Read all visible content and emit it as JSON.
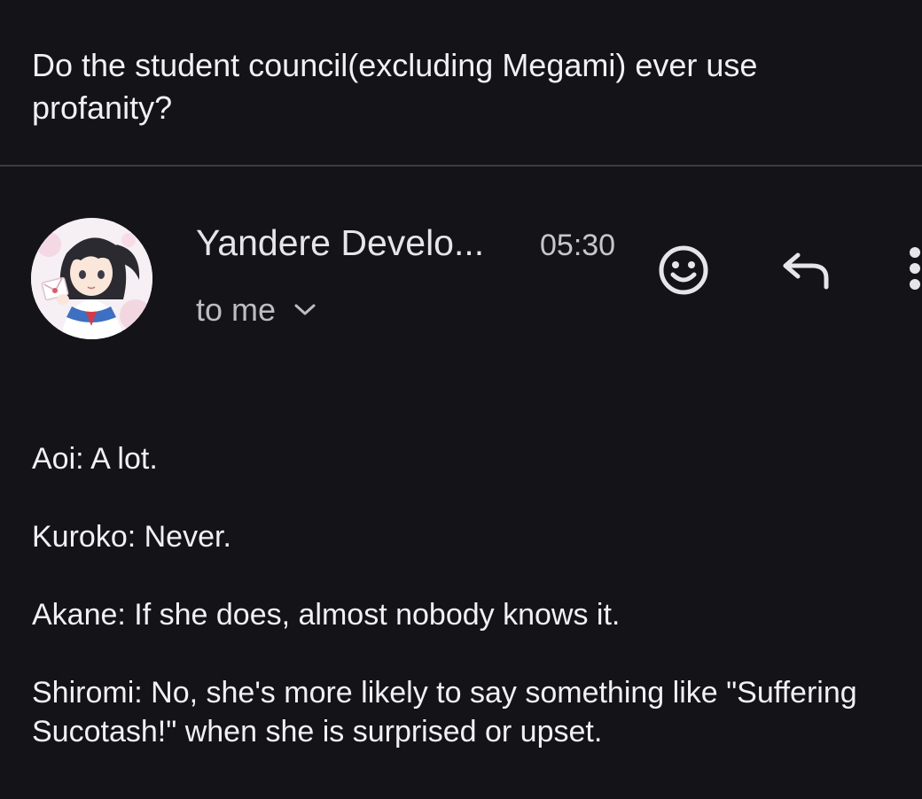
{
  "email": {
    "subject": "Do the student council(excluding Megami) ever use profanity?",
    "sender": {
      "name": "Yandere Develo...",
      "time": "05:30",
      "recipient_label": "to me",
      "avatar": "anime-girl-avatar"
    },
    "actions": {
      "react_icon": "smiley-icon",
      "reply_icon": "reply-arrow-icon",
      "more_icon": "more-vertical-icon",
      "recipient_toggle_icon": "chevron-down-icon"
    },
    "body": [
      "Aoi: A lot.",
      "Kuroko: Never.",
      "Akane: If she does, almost nobody knows it.",
      "Shiromi: No, she's more likely to say something like \"Suffering Sucotash!\" when she is surprised or upset."
    ]
  },
  "colors": {
    "background": "#131318",
    "text": "#f1f1f4",
    "secondary_text": "#bcbcc2",
    "divider": "#3c3c43"
  }
}
